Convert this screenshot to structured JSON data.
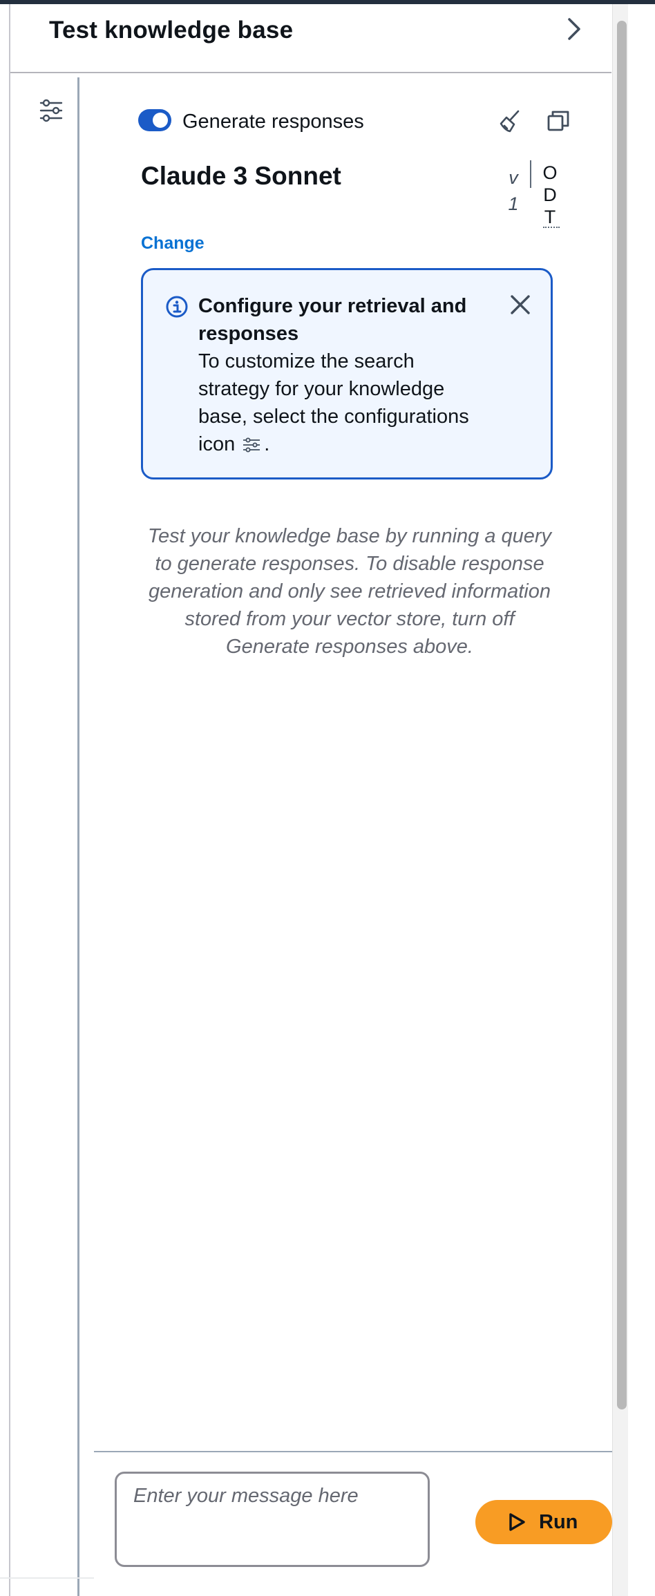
{
  "panel": {
    "title": "Test knowledge base"
  },
  "toolbar": {
    "generate_responses_label": "Generate responses",
    "generate_responses_enabled": true
  },
  "model": {
    "name": "Claude 3 Sonnet",
    "version_letter": "v",
    "version_number": "1",
    "od_chars": [
      "O",
      "D",
      "T"
    ],
    "change_label": "Change"
  },
  "info_alert": {
    "title": "Configure your retrieval and responses",
    "body": "To customize the search strategy for your knowledge base, select the configurations icon",
    "body_end": "."
  },
  "hint": {
    "text": "Test your knowledge base by running a query to generate responses. To disable response generation and only see retrieved information stored from your vector store, turn off Generate responses above."
  },
  "composer": {
    "placeholder": "Enter your message here",
    "value": "",
    "run_label": "Run"
  },
  "colors": {
    "accent_blue": "#1b5bc7",
    "link_blue": "#0972d3",
    "run_orange": "#f89c24",
    "alert_bg": "#f0f6ff"
  }
}
